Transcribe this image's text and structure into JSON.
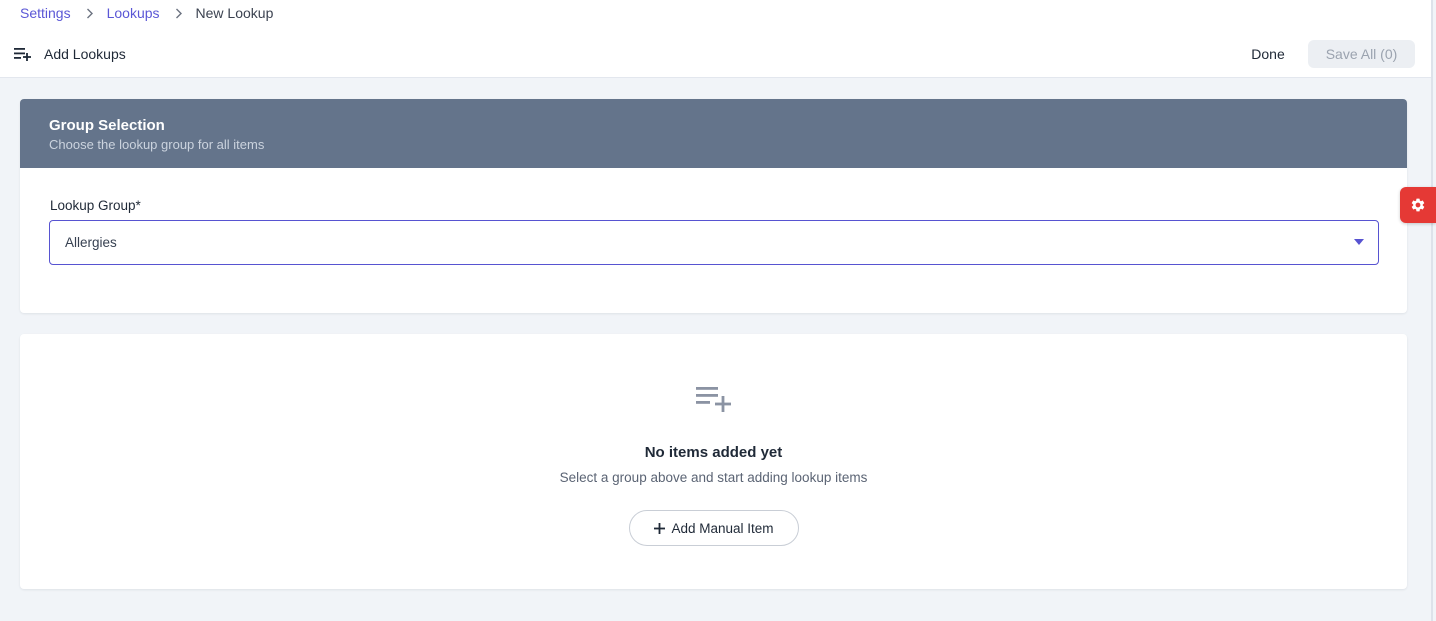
{
  "breadcrumb": {
    "items": [
      "Settings",
      "Lookups"
    ],
    "current": "New Lookup"
  },
  "toolbar": {
    "title": "Add Lookups",
    "done_label": "Done",
    "save_label": "Save All (0)"
  },
  "group_selection": {
    "title": "Group Selection",
    "subtitle": "Choose the lookup group for all items",
    "field_label": "Lookup Group*",
    "selected_value": "Allergies"
  },
  "empty_state": {
    "title": "No items added yet",
    "subtitle": "Select a group above and start adding lookup items",
    "button_label": "Add Manual Item"
  },
  "icons": {
    "toolbar": "playlist-add-icon",
    "breadcrumb_separator": "chevron-right-icon",
    "dropdown": "caret-down-icon",
    "empty": "playlist-add-icon",
    "add": "plus-icon",
    "settings": "gear-icon"
  },
  "colors": {
    "accent": "#5753d1",
    "card_header": "#64748b",
    "settings_button": "#e53935",
    "page_background": "#f1f4f8"
  }
}
